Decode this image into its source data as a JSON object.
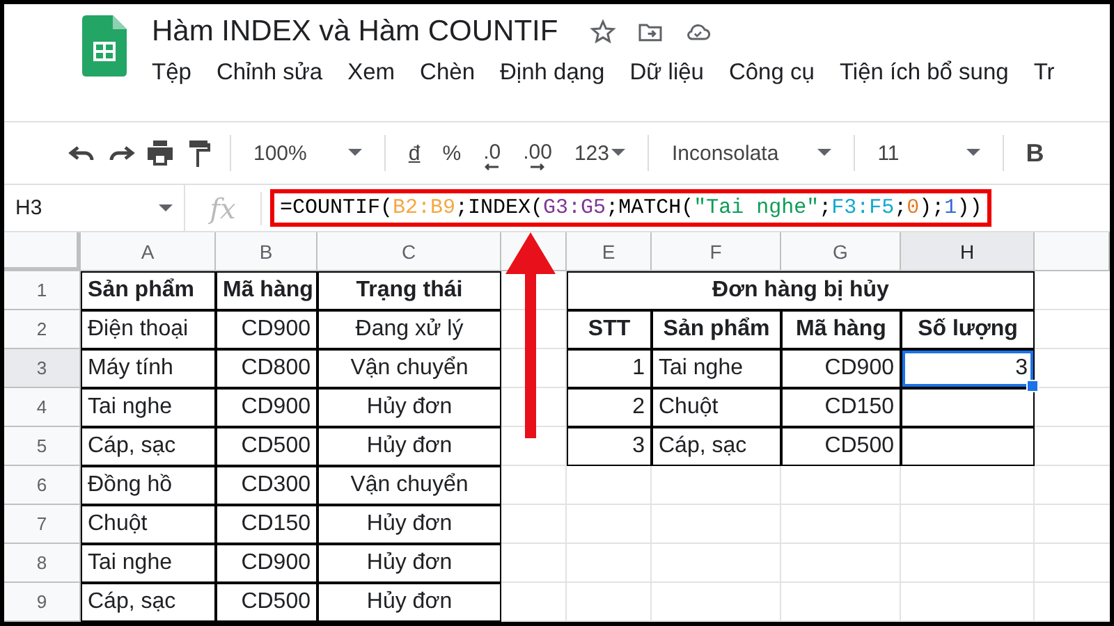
{
  "document": {
    "title": "Hàm INDEX và Hàm COUNTIF"
  },
  "menu": [
    "Tệp",
    "Chỉnh sửa",
    "Xem",
    "Chèn",
    "Định dạng",
    "Dữ liệu",
    "Công cụ",
    "Tiện ích bổ sung",
    "Tr"
  ],
  "toolbar": {
    "zoom": "100%",
    "currency": "đ",
    "percent": "%",
    "decrease_decimals": ".0",
    "increase_decimals": ".00",
    "number_format": "123",
    "font": "Inconsolata",
    "font_size": "11",
    "bold": "B"
  },
  "formula_bar": {
    "name_box": "H3",
    "fx": "fx",
    "formula": [
      {
        "text": "=COUNTIF(",
        "color": "#000000"
      },
      {
        "text": "B2:B9",
        "color": "#f4a742"
      },
      {
        "text": ";INDEX(",
        "color": "#000000"
      },
      {
        "text": "G3:G5",
        "color": "#7e3794"
      },
      {
        "text": ";MATCH(",
        "color": "#000000"
      },
      {
        "text": "\"Tai nghe\"",
        "color": "#0f9d58"
      },
      {
        "text": ";",
        "color": "#000000"
      },
      {
        "text": "F3:F5",
        "color": "#11a9cc"
      },
      {
        "text": ";",
        "color": "#000000"
      },
      {
        "text": "0",
        "color": "#e67c26"
      },
      {
        "text": ");",
        "color": "#000000"
      },
      {
        "text": "1",
        "color": "#3367d6"
      },
      {
        "text": "))",
        "color": "#000000"
      }
    ]
  },
  "columns": [
    {
      "label": "A",
      "selected": false
    },
    {
      "label": "B",
      "selected": false
    },
    {
      "label": "C",
      "selected": false
    },
    {
      "selected": false
    },
    {
      "label": "E",
      "selected": false
    },
    {
      "label": "F",
      "selected": false
    },
    {
      "label": "G",
      "selected": false
    },
    {
      "label": "H",
      "selected": true
    }
  ],
  "row_headers": [
    {
      "label": "1",
      "selected": false
    },
    {
      "label": "2",
      "selected": false
    },
    {
      "label": "3",
      "selected": true
    },
    {
      "label": "4",
      "selected": false
    },
    {
      "label": "5",
      "selected": false
    },
    {
      "label": "6",
      "selected": false
    },
    {
      "label": "7",
      "selected": false
    },
    {
      "label": "8",
      "selected": false
    },
    {
      "label": "9",
      "selected": false
    }
  ],
  "left_table": {
    "header": [
      "Sản phẩm",
      "Mã hàng",
      "Trạng thái"
    ],
    "rows": [
      [
        "Điện thoại",
        "CD900",
        "Đang xử lý"
      ],
      [
        "Máy tính",
        "CD800",
        "Vận chuyển"
      ],
      [
        "Tai nghe",
        "CD900",
        "Hủy đơn"
      ],
      [
        "Cáp, sạc",
        "CD500",
        "Hủy đơn"
      ],
      [
        "Đồng hồ",
        "CD300",
        "Vận chuyển"
      ],
      [
        "Chuột",
        "CD150",
        "Hủy đơn"
      ],
      [
        "Tai nghe",
        "CD900",
        "Hủy đơn"
      ],
      [
        "Cáp, sạc",
        "CD500",
        "Hủy đơn"
      ]
    ]
  },
  "right_table": {
    "title": "Đơn hàng bị hủy",
    "header": [
      "STT",
      "Sản phẩm",
      "Mã hàng",
      "Số lượng"
    ],
    "rows": [
      [
        {
          "text": "1",
          "selected": false
        },
        {
          "text": "Tai nghe",
          "selected": false
        },
        {
          "text": "CD900",
          "selected": false
        },
        {
          "text": "3",
          "selected": true
        }
      ],
      [
        {
          "text": "2",
          "selected": false
        },
        {
          "text": "Chuột",
          "selected": false
        },
        {
          "text": "CD150",
          "selected": false
        },
        {
          "selected": false
        }
      ],
      [
        {
          "text": "3",
          "selected": false
        },
        {
          "text": "Cáp, sạc",
          "selected": false
        },
        {
          "text": "CD500",
          "selected": false
        },
        {
          "selected": false
        }
      ]
    ]
  }
}
